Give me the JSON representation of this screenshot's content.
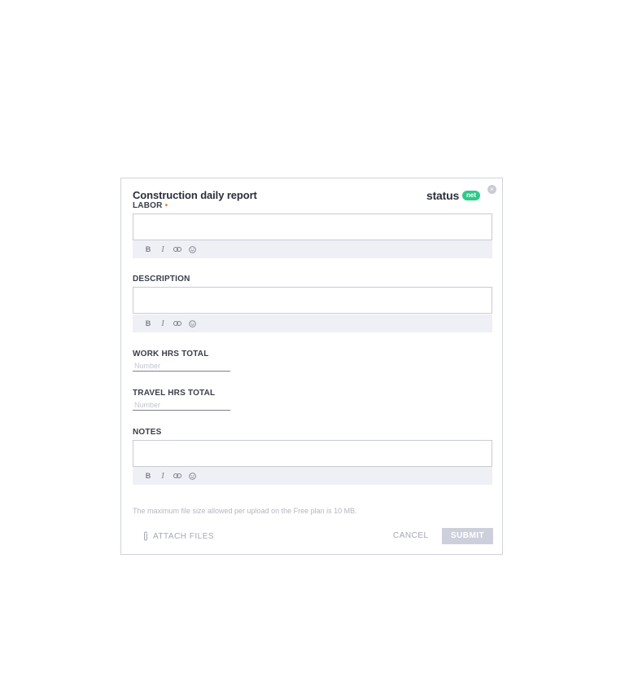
{
  "form": {
    "title": "Construction daily report",
    "close_glyph": "×"
  },
  "brand": {
    "word": "status",
    "pill": "net",
    "accent_color": "#2fc98a"
  },
  "fields": [
    {
      "label": "LABOR",
      "required_mark": "•",
      "type": "rich-text"
    },
    {
      "label": "DESCRIPTION",
      "type": "rich-text"
    },
    {
      "label": "WORK HRS TOTAL",
      "type": "number",
      "placeholder": "Number"
    },
    {
      "label": "TRAVEL HRS TOTAL",
      "type": "number",
      "placeholder": "Number"
    },
    {
      "label": "NOTES",
      "type": "rich-text"
    }
  ],
  "toolbar": {
    "bold": "B",
    "italic": "I",
    "icons": [
      "link-icon",
      "emoji-icon"
    ]
  },
  "footer": {
    "size_note": "The maximum file size allowed per upload on the Free plan is 10 MB.",
    "attach_label": "ATTACH FILES",
    "cancel_label": "CANCEL",
    "submit_label": "SUBMIT"
  }
}
